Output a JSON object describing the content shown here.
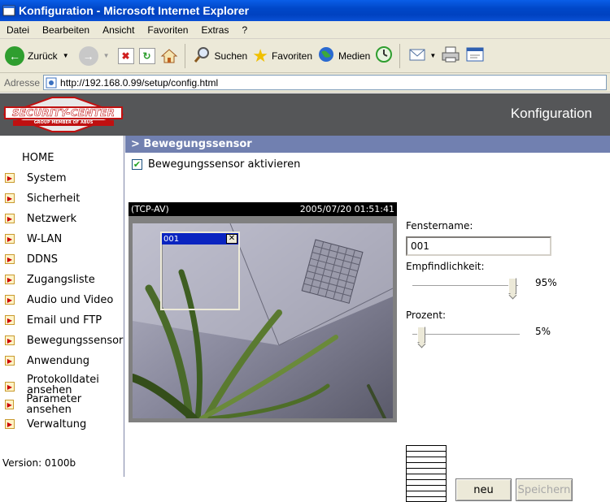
{
  "window": {
    "title": "Konfiguration - Microsoft Internet Explorer"
  },
  "menu": {
    "items": [
      "Datei",
      "Bearbeiten",
      "Ansicht",
      "Favoriten",
      "Extras",
      "?"
    ]
  },
  "toolbar": {
    "back": "Zurück",
    "search": "Suchen",
    "favorites": "Favoriten",
    "media": "Medien"
  },
  "address": {
    "label": "Adresse",
    "url": "http://192.168.0.99/setup/config.html"
  },
  "header": {
    "logo_text": "SECURITY-CENTER",
    "logo_sub": "GROUP MEMBER OF ABUS",
    "title": "Konfiguration"
  },
  "sidebar": {
    "home": "HOME",
    "items": [
      "System",
      "Sicherheit",
      "Netzwerk",
      "W-LAN",
      "DDNS",
      "Zugangsliste",
      "Audio und Video",
      "Email und FTP",
      "Bewegungssensor",
      "Anwendung",
      "Protokolldatei ansehen",
      "Parameter ansehen",
      "Verwaltung"
    ],
    "version": "Version: 0100b"
  },
  "section": {
    "title": "> Bewegungssensor"
  },
  "activate": {
    "label": "Bewegungssensor aktivieren",
    "checked": true
  },
  "video": {
    "source": "(TCP-AV)",
    "timestamp": "2005/07/20 01:51:41",
    "window_label": "001"
  },
  "panel": {
    "window_name_label": "Fenstername:",
    "window_name_value": "001",
    "sensitivity_label": "Empfindlichkeit:",
    "sensitivity_value": "95%",
    "sensitivity_fraction": 0.95,
    "percent_label": "Prozent:",
    "percent_value": "5%",
    "percent_fraction": 0.05,
    "new_button": "neu",
    "save_button": "Speichern"
  },
  "colors": {
    "section_bar": "#7180b0",
    "header_bg": "#555658",
    "selection_blue": "#0a24c0"
  }
}
